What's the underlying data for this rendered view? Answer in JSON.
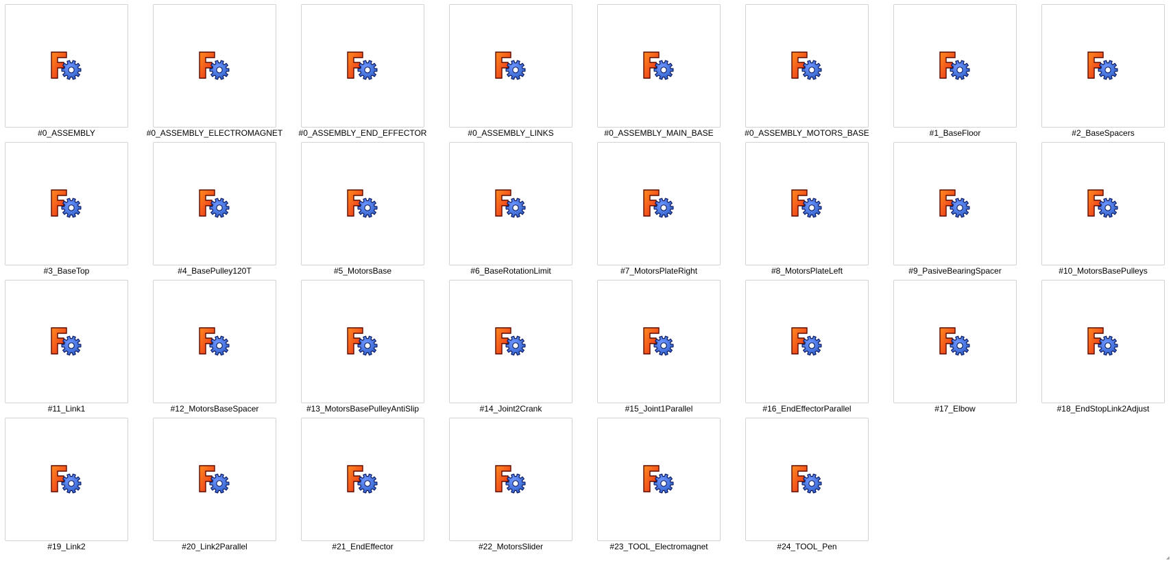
{
  "view": {
    "mode": "extra-large-icons",
    "item_icon": "freecad-document-icon",
    "colors": {
      "icon_red": "#e8281a",
      "icon_orange": "#ff8a1e",
      "icon_gear_blue": "#2f5fc8",
      "icon_gear_dark": "#14226a",
      "thumb_border": "#d2d2d2"
    }
  },
  "files": [
    {
      "name": "#0_ASSEMBLY"
    },
    {
      "name": "#0_ASSEMBLY_ELECTROMAGNET"
    },
    {
      "name": "#0_ASSEMBLY_END_EFFECTOR"
    },
    {
      "name": "#0_ASSEMBLY_LINKS"
    },
    {
      "name": "#0_ASSEMBLY_MAIN_BASE"
    },
    {
      "name": "#0_ASSEMBLY_MOTORS_BASE"
    },
    {
      "name": "#1_BaseFloor"
    },
    {
      "name": "#2_BaseSpacers"
    },
    {
      "name": "#3_BaseTop"
    },
    {
      "name": "#4_BasePulley120T"
    },
    {
      "name": "#5_MotorsBase"
    },
    {
      "name": "#6_BaseRotationLimit"
    },
    {
      "name": "#7_MotorsPlateRight"
    },
    {
      "name": "#8_MotorsPlateLeft"
    },
    {
      "name": "#9_PasiveBearingSpacer"
    },
    {
      "name": "#10_MotorsBasePulleys"
    },
    {
      "name": "#11_Link1"
    },
    {
      "name": "#12_MotorsBaseSpacer"
    },
    {
      "name": "#13_MotorsBasePulleyAntiSlip"
    },
    {
      "name": "#14_Joint2Crank"
    },
    {
      "name": "#15_Joint1Parallel"
    },
    {
      "name": "#16_EndEffectorParallel"
    },
    {
      "name": "#17_Elbow"
    },
    {
      "name": "#18_EndStopLink2Adjust"
    },
    {
      "name": "#19_Link2"
    },
    {
      "name": "#20_Link2Parallel"
    },
    {
      "name": "#21_EndEffector"
    },
    {
      "name": "#22_MotorsSlider"
    },
    {
      "name": "#23_TOOL_Electromagnet"
    },
    {
      "name": "#24_TOOL_Pen"
    }
  ]
}
